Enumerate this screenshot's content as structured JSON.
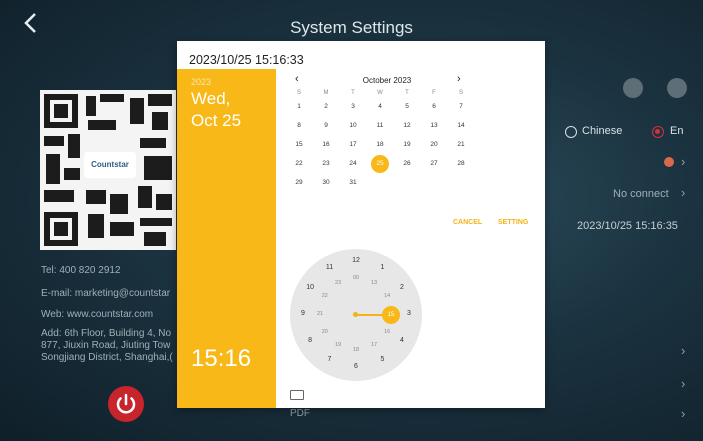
{
  "header": {
    "title": "System Settings",
    "back_icon": "chevron-left-icon"
  },
  "contact": {
    "qr_logo_text": "Countstar",
    "tel": "Tel: 400 820 2912",
    "email": "E-mail: marketing@countstar",
    "web": "Web: www.countstar.com",
    "address_lines": [
      "Add: 6th Floor, Building 4, No",
      "877, Jiuxin Road, Jiuting Tow",
      "Songjiang District, Shanghai,("
    ]
  },
  "right_panel": {
    "lang_chinese": "Chinese",
    "lang_en": "En",
    "network": "No connect",
    "datetime": "2023/10/25 15:16:35",
    "pdf_label": "PDF"
  },
  "dialog": {
    "title": "2023/10/25 15:16:33",
    "year": "2023",
    "date_line1": "Wed,",
    "date_line2": "Oct 25",
    "time": "15:16",
    "month_label": "October 2023",
    "weekdays": [
      "S",
      "M",
      "T",
      "W",
      "T",
      "F",
      "S"
    ],
    "weeks": [
      [
        "1",
        "2",
        "3",
        "4",
        "5",
        "6",
        "7"
      ],
      [
        "8",
        "9",
        "10",
        "11",
        "12",
        "13",
        "14"
      ],
      [
        "15",
        "16",
        "17",
        "18",
        "19",
        "20",
        "21"
      ],
      [
        "22",
        "23",
        "24",
        "25",
        "26",
        "27",
        "28"
      ],
      [
        "29",
        "30",
        "31",
        "",
        "",
        "",
        ""
      ]
    ],
    "selected_day": "25",
    "cancel_label": "CANCEL",
    "setting_label": "SETTING",
    "clock_hours": [
      "12",
      "1",
      "2",
      "3",
      "4",
      "5",
      "6",
      "7",
      "8",
      "9",
      "10",
      "11"
    ],
    "clock_minutes": [
      "00",
      "13",
      "14",
      "15",
      "16",
      "17",
      "18",
      "19",
      "20",
      "21",
      "22",
      "23"
    ],
    "selected_minute": "15"
  },
  "colors": {
    "accent": "#F7B818",
    "power": "#C8242C",
    "dialog_bg": "#FFFFFF"
  }
}
